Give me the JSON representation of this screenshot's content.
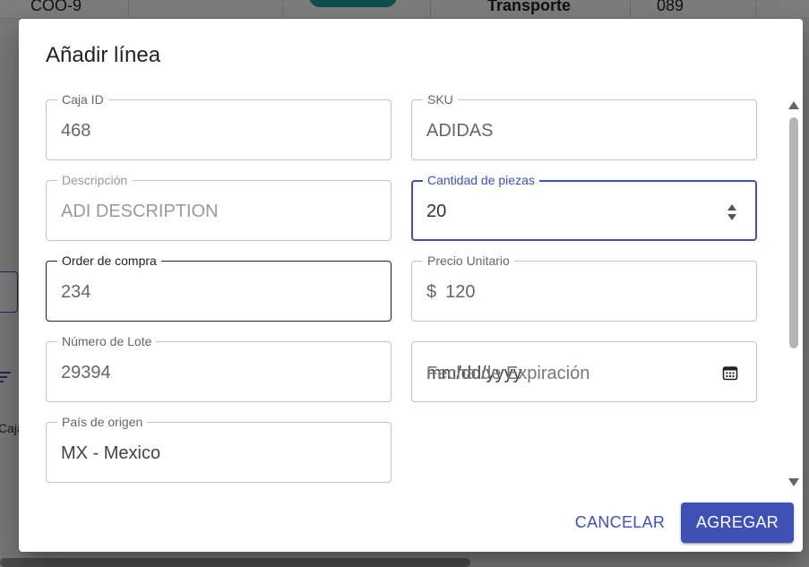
{
  "background": {
    "row": {
      "code": "COO-9",
      "type": "Transporte",
      "number": "089"
    },
    "caja_label": "Caja",
    "filter_icon": "filter-icon"
  },
  "dialog": {
    "title": "Añadir línea",
    "fields": {
      "caja_id": {
        "label": "Caja ID",
        "value": "468"
      },
      "sku": {
        "label": "SKU",
        "value": "ADIDAS"
      },
      "descripcion": {
        "label": "Descripción",
        "value": "ADI DESCRIPTION"
      },
      "cantidad": {
        "label": "Cantidad de piezas",
        "value": "20"
      },
      "orden_compra": {
        "label": "Order de compra",
        "value": "234"
      },
      "precio": {
        "label": "Precio Unitario",
        "prefix": "$",
        "value": "120"
      },
      "lote": {
        "label": "Número de Lote",
        "value": "29394"
      },
      "fecha": {
        "placeholder": "Fecha de Expiración",
        "format": "mm/dd/yyyy"
      },
      "pais": {
        "label": "País de origen",
        "value": "MX - Mexico"
      }
    },
    "actions": {
      "cancel": "CANCELAR",
      "add": "AGREGAR"
    }
  },
  "colors": {
    "primary": "#3f51b5",
    "teal": "#1aa39a"
  }
}
